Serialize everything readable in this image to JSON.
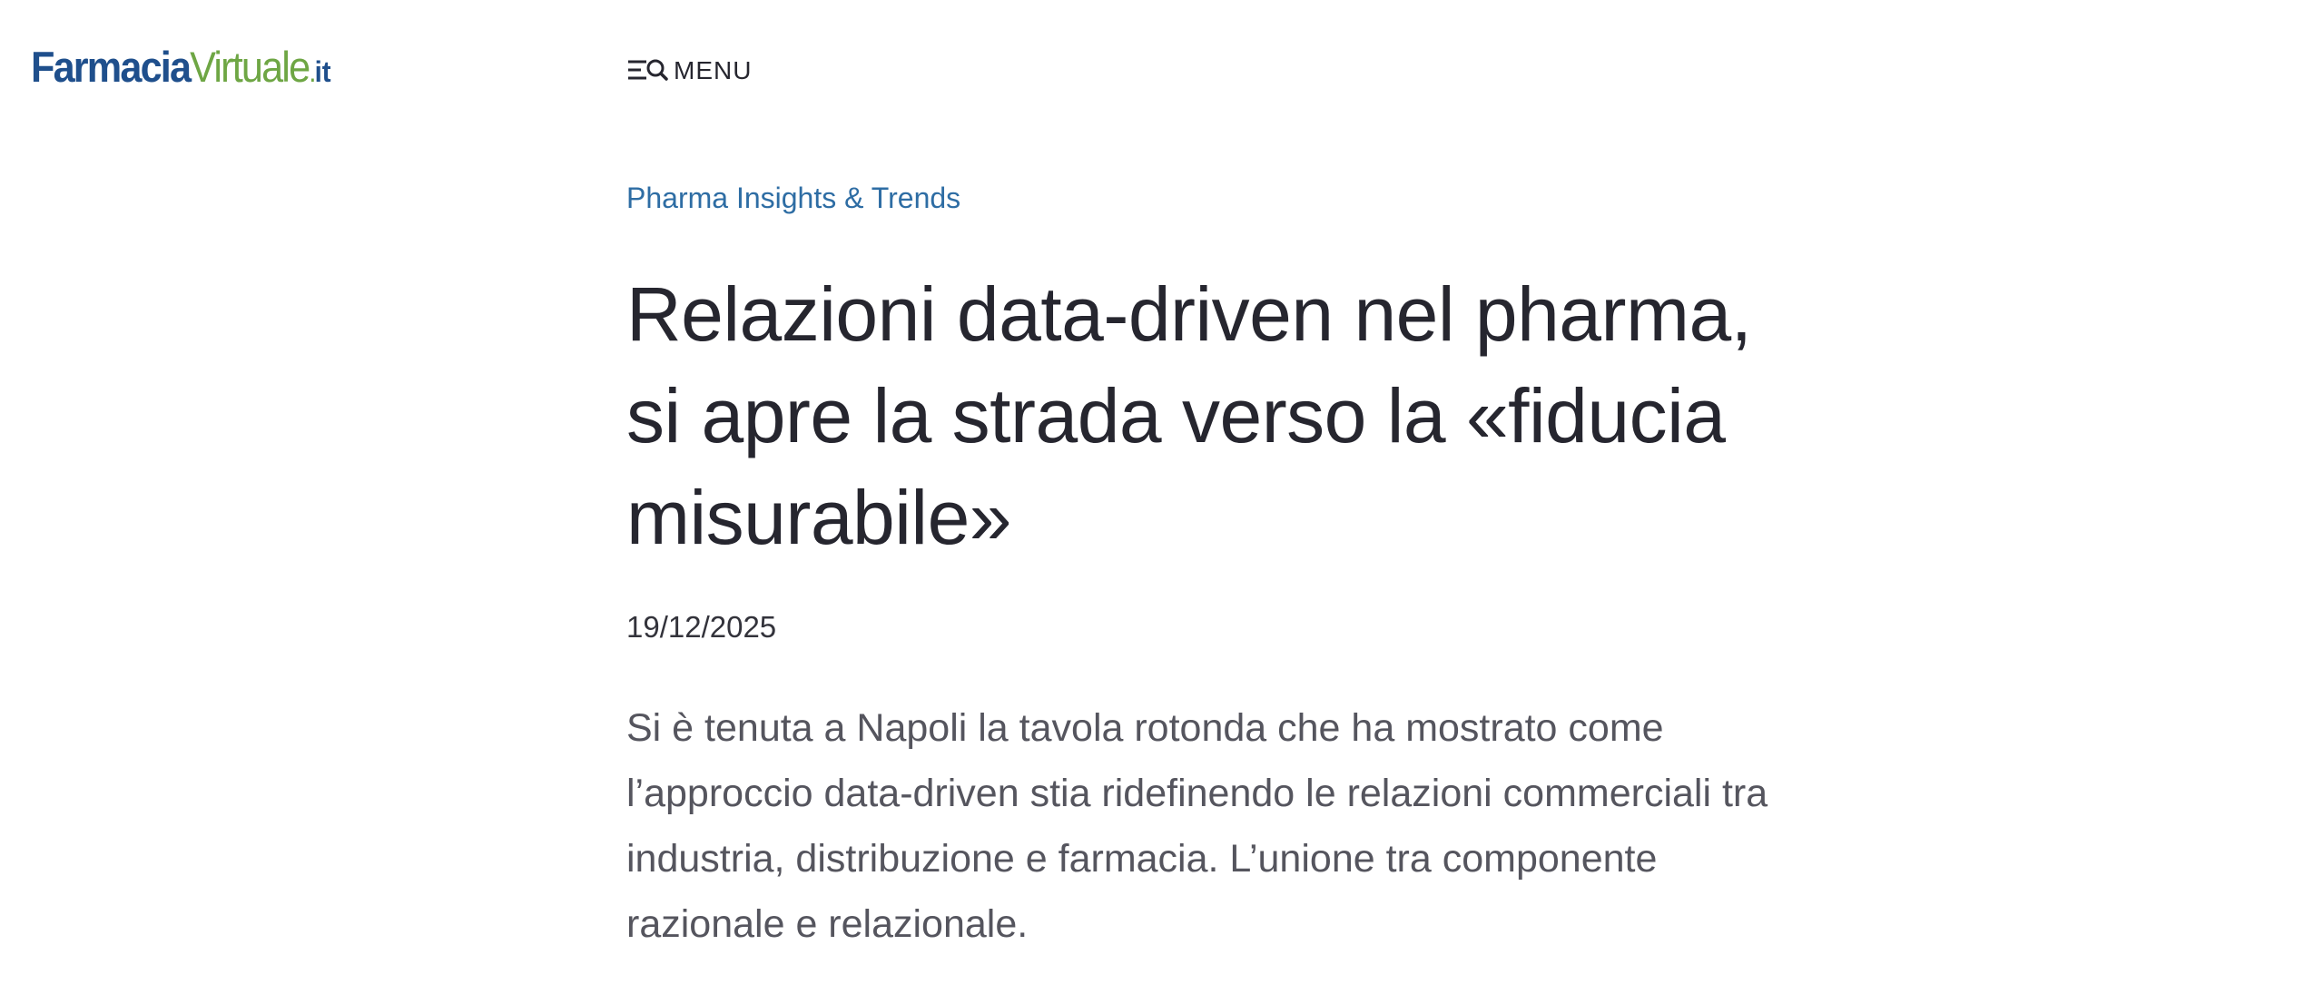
{
  "header": {
    "logo": {
      "part1": "Farmacia",
      "part2": "Virtuale",
      "dot": ".",
      "tld": "it"
    },
    "menu_label": "MENU"
  },
  "article": {
    "category": "Pharma Insights & Trends",
    "title": "Relazioni data-driven nel pharma, si apre la strada verso la «fiducia misurabile»",
    "date": "19/12/2025",
    "abstract": "Si è tenuta a Napoli la tavola rotonda che ha mostrato come l’approccio data-driven stia ridefinendo le relazioni commerciali tra industria, distribuzione e farmacia. L’unione tra componente razionale e relazionale."
  },
  "colors": {
    "logo_blue": "#1f4f8c",
    "logo_green": "#6ea644",
    "category_blue": "#2e6da4",
    "title_text": "#26262f",
    "body_text": "#55555e"
  },
  "icons": {
    "menu": "menu-search-icon"
  }
}
